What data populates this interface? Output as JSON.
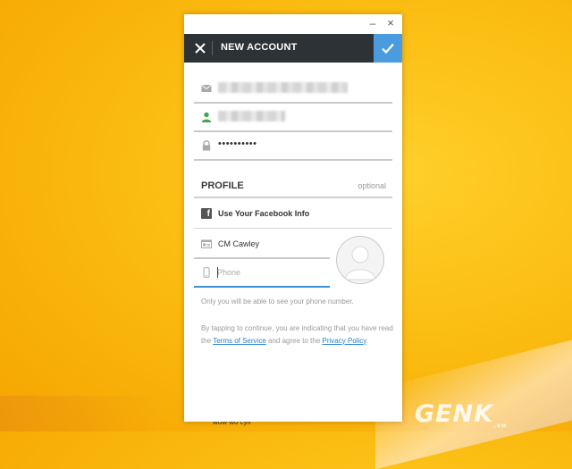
{
  "window": {
    "minimize_glyph": "–",
    "close_glyph": "×"
  },
  "header": {
    "title": "NEW ACCOUNT",
    "close_icon": "close-icon",
    "confirm_icon": "checkmark-icon",
    "confirm_color": "#4a9be0"
  },
  "account": {
    "password_value": "••••••••••"
  },
  "profile": {
    "title": "PROFILE",
    "optional_label": "optional",
    "facebook_label": "Use Your Facebook Info",
    "name_value": "CM Cawley",
    "phone_placeholder": "Phone",
    "phone_value": "",
    "phone_note": "Only you will be able to see your phone number."
  },
  "terms": {
    "text_before": "By tapping to continue, you are indicating that you have read the ",
    "terms_link": "Terms of Service",
    "text_middle": " and agree to the ",
    "privacy_link": "Privacy Policy",
    "text_after": "."
  },
  "watermark": {
    "text": "GENK",
    "suffix": ".vn"
  },
  "background_text": "wow wo cyll"
}
